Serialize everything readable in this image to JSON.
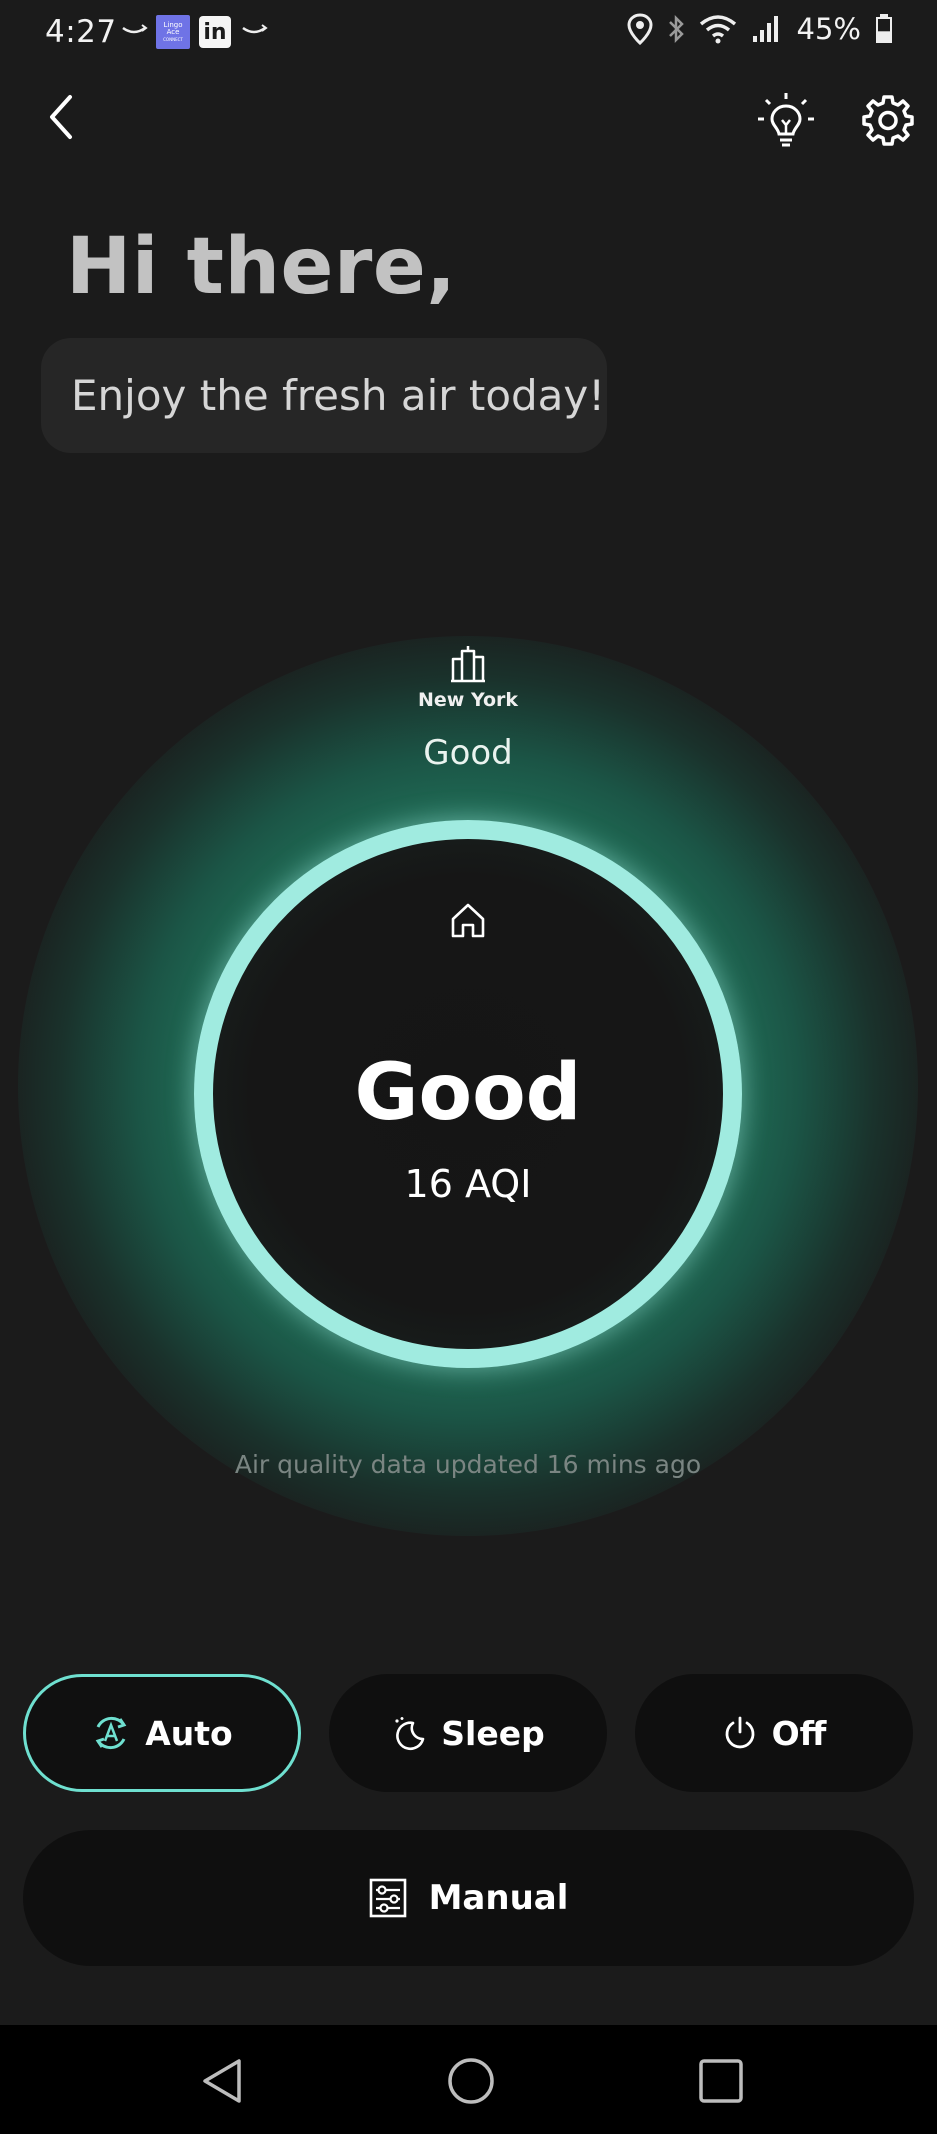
{
  "status_bar": {
    "time": "4:27",
    "notification_icons": [
      "amazon-smile-icon",
      "lingoace-icon",
      "linkedin-icon",
      "amazon-smile-icon"
    ],
    "lingoace_label": "Lingo Ace",
    "lingoace_sub": "CONNECT",
    "linkedin_label": "in",
    "system_icons": [
      "location-icon",
      "bluetooth-icon",
      "wifi-icon",
      "signal-icon"
    ],
    "battery_percent": "45%",
    "battery_level": 0.45
  },
  "top_bar": {
    "back_icon": "chevron-left-icon",
    "actions": [
      "lightbulb-icon",
      "gear-icon"
    ]
  },
  "greeting": {
    "title": "Hi there,",
    "message": "Enjoy the fresh air today!"
  },
  "outdoor": {
    "icon": "city-buildings-icon",
    "city": "New York",
    "status": "Good"
  },
  "indoor": {
    "icon": "home-icon",
    "status": "Good",
    "aqi": "16 AQI"
  },
  "updated_text": "Air quality data updated 16 mins ago",
  "modes": [
    {
      "label": "Auto",
      "icon": "auto-mode-icon",
      "selected": true
    },
    {
      "label": "Sleep",
      "icon": "moon-icon",
      "selected": false
    },
    {
      "label": "Off",
      "icon": "power-icon",
      "selected": false
    }
  ],
  "manual": {
    "label": "Manual",
    "icon": "sliders-icon"
  },
  "nav_bar": [
    "nav-back-icon",
    "nav-home-icon",
    "nav-recents-icon"
  ],
  "colors": {
    "background": "#1b1b1b",
    "accent_teal": "#6fe0d0",
    "ring": "#a0ebe0",
    "glow": "#268c6c",
    "button_bg": "#0f0f0f"
  }
}
